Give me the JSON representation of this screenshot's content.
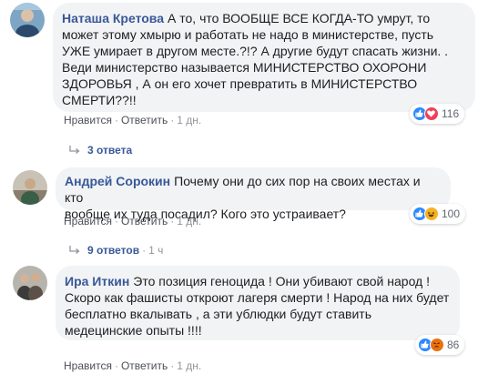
{
  "comments": [
    {
      "author": "Наташа Кретова",
      "text": "А то, что ВООБЩЕ ВСЕ КОГДА-ТО умрут, то\nможет этому хмырю и работать не надо в министерстве, пусть\nУЖЕ умирает в другом месте.?!? А другие будут спасать жизни. .\nВеди министерство называется МИНИСТЕРСТВО ОХОРОНИ\nЗДОРОВЬЯ , А он его хочет превратить в МИНИСТЕРСТВО\nСМЕРТИ??!!",
      "like_label": "Нравится",
      "reply_label": "Ответить",
      "time": "1 дн.",
      "reaction_icons": [
        "like-icon",
        "love-icon"
      ],
      "reaction_count": "116",
      "replies_label": "3 ответа",
      "replies_time": ""
    },
    {
      "author": "Андрей Сорокин",
      "text": "Почему они до сих пор на своих местах и кто\nвообще их туда посадил? Кого это устраивает?",
      "like_label": "Нравится",
      "reply_label": "Ответить",
      "time": "1 дн.",
      "reaction_icons": [
        "like-icon",
        "haha-icon"
      ],
      "reaction_count": "100",
      "replies_label": "9 ответов",
      "replies_time": "1 ч"
    },
    {
      "author": "Ира Иткин",
      "text": "Это позиция геноцида ! Они убивают свой народ !\nСкоро как фашисты откроют лагеря смерти ! Народ на них будет\nбесплатно вкалывать , а эти ублюдки будут ставить\nмедецинские опыты !!!!",
      "like_label": "Нравится",
      "reply_label": "Ответить",
      "time": "1 дн.",
      "reaction_icons": [
        "like-icon",
        "angry-icon"
      ],
      "reaction_count": "86"
    }
  ],
  "colors": {
    "bubble": "#f2f3f5",
    "author": "#385898",
    "meta": "#90949c",
    "like": "#2d88ff",
    "love": "#f33e58",
    "haha": "#f7b125",
    "angry": "#e9710f"
  }
}
